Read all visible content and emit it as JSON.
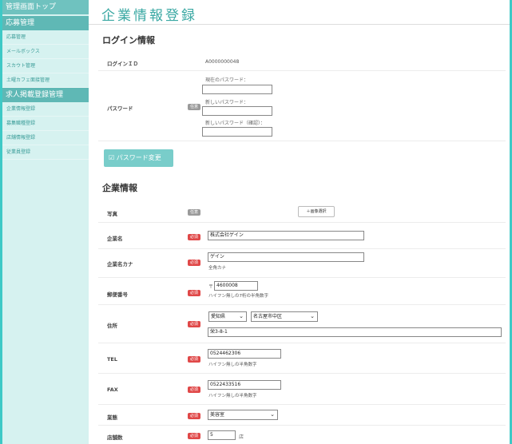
{
  "sidebar": {
    "top": "管理画面トップ",
    "groups": [
      {
        "label": "応募管理",
        "items": [
          "応募管理",
          "メールボックス",
          "スカウト管理",
          "土曜カフェ面接管理"
        ]
      },
      {
        "label": "求人掲載登録管理",
        "items": [
          "企業情報登録",
          "募集職種登録",
          "店舗情報登録",
          "従業員登録"
        ]
      }
    ]
  },
  "page_title": "企業情報登録",
  "login": {
    "heading": "ログイン情報",
    "id_label": "ログインＩＤ",
    "id_value": "A0000000048",
    "password_label": "パスワード",
    "badge_optional": "任意",
    "current_pw_label": "現在のパスワード：",
    "new_pw_label": "新しいパスワード：",
    "new_pw_confirm_label": "新しいパスワード（確認）：",
    "change_button": "パスワード変更",
    "change_icon": "checkbox-icon"
  },
  "company": {
    "heading": "企業情報",
    "badge_required": "必須",
    "photo_label": "写真",
    "image_select_button": "＋画像選択",
    "name_label": "企業名",
    "name_value": "株式会社ゲイン",
    "kana_label": "企業名カナ",
    "kana_value": "ゲイン",
    "kana_note": "全角カナ",
    "zip_label": "郵便番号",
    "zip_prefix": "〒",
    "zip_value": "4600008",
    "zip_note": "ハイフン無しの7桁の半角数字",
    "address_label": "住所",
    "prefecture_value": "愛知県",
    "city_value": "名古屋市中区",
    "street_value": "栄3-8-1",
    "tel_label": "TEL",
    "tel_value": "0524462306",
    "tel_note": "ハイフン無しの半角数字",
    "fax_label": "FAX",
    "fax_value": "0522433516",
    "fax_note": "ハイフン無しの半角数字",
    "industry_label": "業態",
    "industry_value": "美容室",
    "stores_label": "店舗数",
    "stores_value": "5",
    "stores_unit": "店"
  }
}
